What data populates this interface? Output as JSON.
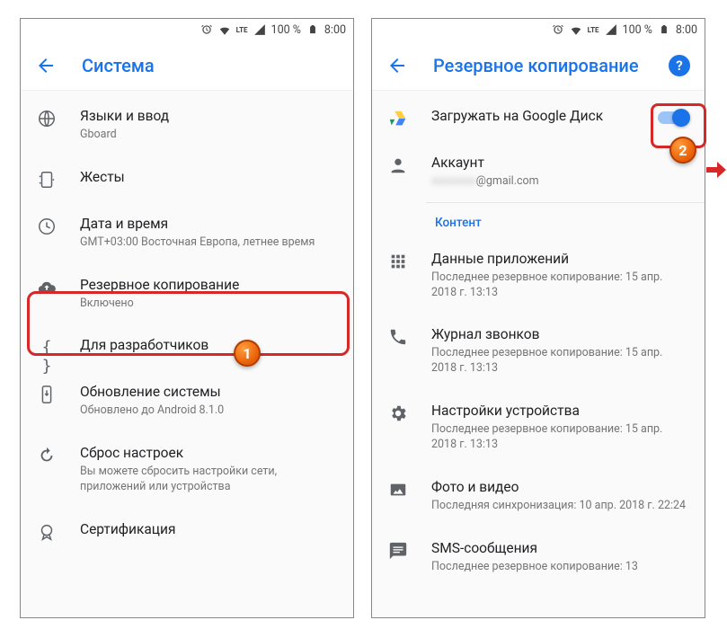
{
  "status": {
    "battery": "100 %",
    "time": "8:00",
    "net": "LTE"
  },
  "left": {
    "title": "Система",
    "items": [
      {
        "title": "Языки и ввод",
        "sub": "Gboard"
      },
      {
        "title": "Жесты",
        "sub": ""
      },
      {
        "title": "Дата и время",
        "sub": "GMT+03:00 Восточная Европа, летнее время"
      },
      {
        "title": "Резервное копирование",
        "sub": "Включено"
      },
      {
        "title": "Для разработчиков",
        "sub": ""
      },
      {
        "title": "Обновление системы",
        "sub": "Обновлено до Android 8.1.0"
      },
      {
        "title": "Сброс настроек",
        "sub": "Вы можете сбросить настройки сети, приложений или устройства"
      },
      {
        "title": "Сертификация",
        "sub": ""
      }
    ]
  },
  "right": {
    "title": "Резервное копирование",
    "upload": {
      "title": "Загружать на Google Диск"
    },
    "account": {
      "title": "Аккаунт",
      "sub": "@gmail.com"
    },
    "section": "Контент",
    "items": [
      {
        "title": "Данные приложений",
        "sub": "Последнее резервное копирование: 15 апр. 2018 г. 13:13"
      },
      {
        "title": "Журнал звонков",
        "sub": "Последнее резервное копирование: 15 апр. 2018 г. 13:13"
      },
      {
        "title": "Настройки устройства",
        "sub": "Последнее резервное копирование: 15 апр. 2018 г. 13:13"
      },
      {
        "title": "Фото и видео",
        "sub": "Последняя синхронизация: 10 апр. 2018 г. 22:24"
      },
      {
        "title": "SMS-сообщения",
        "sub": "Последнее резервное копирование: 13"
      }
    ]
  },
  "markers": {
    "one": "1",
    "two": "2"
  },
  "help": "?"
}
